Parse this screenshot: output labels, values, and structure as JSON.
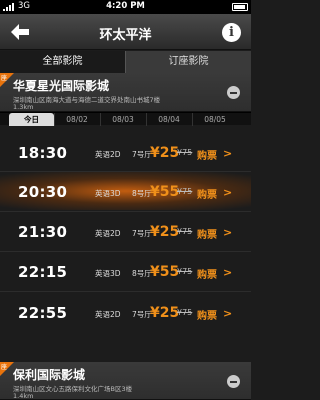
{
  "status": {
    "carrier": "3G",
    "time": "4:20 PM"
  },
  "nav": {
    "title": "环太平洋"
  },
  "tabs": {
    "all": "全部影院",
    "booked": "订座影院"
  },
  "cinema1": {
    "badge": "座",
    "name": "华夏星光国际影城",
    "address": "深圳南山区南海大道与海德二道交界处南山书城7楼",
    "distance": "1.3km"
  },
  "dates": [
    "今日",
    "08/02",
    "08/03",
    "08/04",
    "08/05"
  ],
  "shows": [
    {
      "time": "18:30",
      "version": "英语2D",
      "hall": "7号厅",
      "price": "¥25",
      "original": "¥75",
      "buy": "购票"
    },
    {
      "time": "20:30",
      "version": "英语3D",
      "hall": "8号厅",
      "price": "¥55",
      "original": "¥75",
      "buy": "购票"
    },
    {
      "time": "21:30",
      "version": "英语2D",
      "hall": "7号厅",
      "price": "¥25",
      "original": "¥75",
      "buy": "购票"
    },
    {
      "time": "22:15",
      "version": "英语3D",
      "hall": "8号厅",
      "price": "¥55",
      "original": "¥75",
      "buy": "购票"
    },
    {
      "time": "22:55",
      "version": "英语2D",
      "hall": "7号厅",
      "price": "¥25",
      "original": "¥75",
      "buy": "购票"
    }
  ],
  "cinema2": {
    "badge": "座",
    "name": "保利国际影城",
    "address": "深圳南山区文心五路保利文化广场B区3楼",
    "distance": "1.4km"
  },
  "colors": {
    "accent": "#f0901a",
    "badge": "#e8730c",
    "highlight": "#c25d10"
  }
}
